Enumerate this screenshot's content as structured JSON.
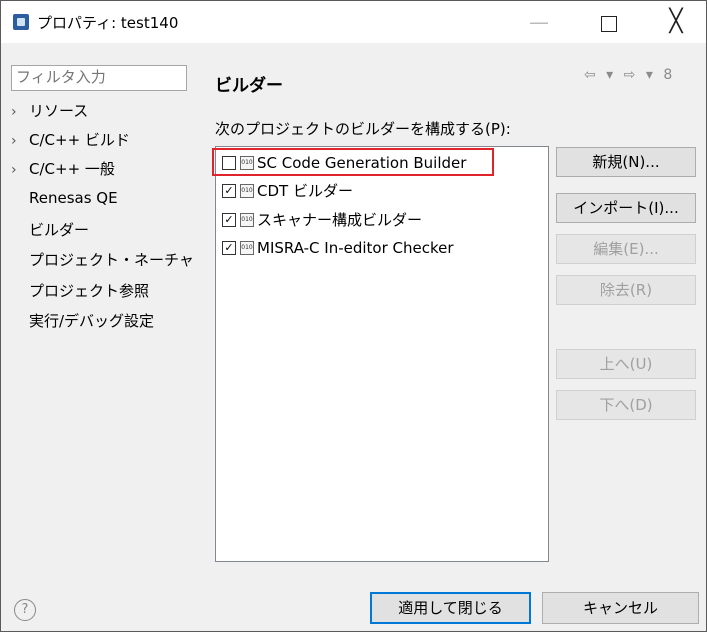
{
  "window": {
    "title": "プロパティ: test140",
    "minimize_glyph": "—",
    "close_glyph": "╳"
  },
  "left": {
    "filter_placeholder": "フィルタ入力",
    "tree": [
      {
        "label": "リソース",
        "expandable": true
      },
      {
        "label": "C/C++ ビルド",
        "expandable": true
      },
      {
        "label": "C/C++ 一般",
        "expandable": true
      },
      {
        "label": "Renesas QE",
        "expandable": false
      },
      {
        "label": "ビルダー",
        "expandable": false,
        "selected": true
      },
      {
        "label": "プロジェクト・ネーチャ",
        "expandable": false
      },
      {
        "label": "プロジェクト参照",
        "expandable": false
      },
      {
        "label": "実行/デバッグ設定",
        "expandable": false
      }
    ],
    "scroll_left": "<",
    "scroll_right": ">"
  },
  "right": {
    "title": "ビルダー",
    "nav": "⇦ ▾ ⇨ ▾ 8",
    "description": "次のプロジェクトのビルダーを構成する(P):",
    "builders": [
      {
        "label": "SC Code Generation Builder",
        "checked": false
      },
      {
        "label": "CDT ビルダー",
        "checked": true
      },
      {
        "label": "スキャナー構成ビルダー",
        "checked": true
      },
      {
        "label": "MISRA-C In-editor Checker",
        "checked": true
      }
    ],
    "buttons": {
      "new": "新規(N)...",
      "import": "インポート(I)...",
      "edit": "編集(E)...",
      "remove": "除去(R)",
      "up": "上へ(U)",
      "down": "下へ(D)"
    }
  },
  "footer": {
    "help": "?",
    "apply_close": "適用して閉じる",
    "cancel": "キャンセル"
  },
  "colors": {
    "highlight_border": "#e0242b",
    "default_button_border": "#0078d7"
  },
  "icons": {
    "builder_icon_text": "010"
  }
}
